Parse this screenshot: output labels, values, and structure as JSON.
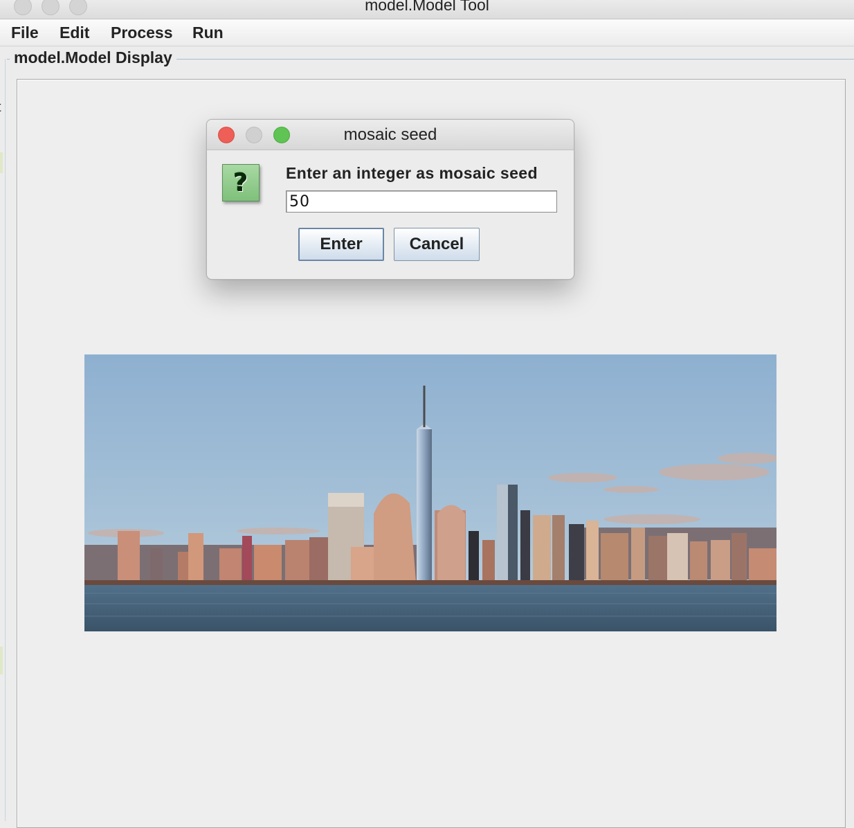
{
  "window": {
    "title": "model.Model Tool"
  },
  "menubar": {
    "items": [
      "File",
      "Edit",
      "Process",
      "Run"
    ]
  },
  "group": {
    "title": "model.Model Display",
    "left_fragment": "t"
  },
  "dialog": {
    "title": "mosaic seed",
    "prompt": "Enter an integer as mosaic seed",
    "input_value": "50",
    "enter_label": "Enter",
    "cancel_label": "Cancel",
    "icon": "question-icon",
    "icon_glyph": "?"
  },
  "image": {
    "subject": "city skyline across water"
  },
  "colors": {
    "close": "#ee5f57",
    "minimize": "#d0d0d0",
    "maximize": "#5fc453",
    "icon_green": "#8fcb8a",
    "sky": "#9dbbd6",
    "water": "#3f5a70"
  }
}
